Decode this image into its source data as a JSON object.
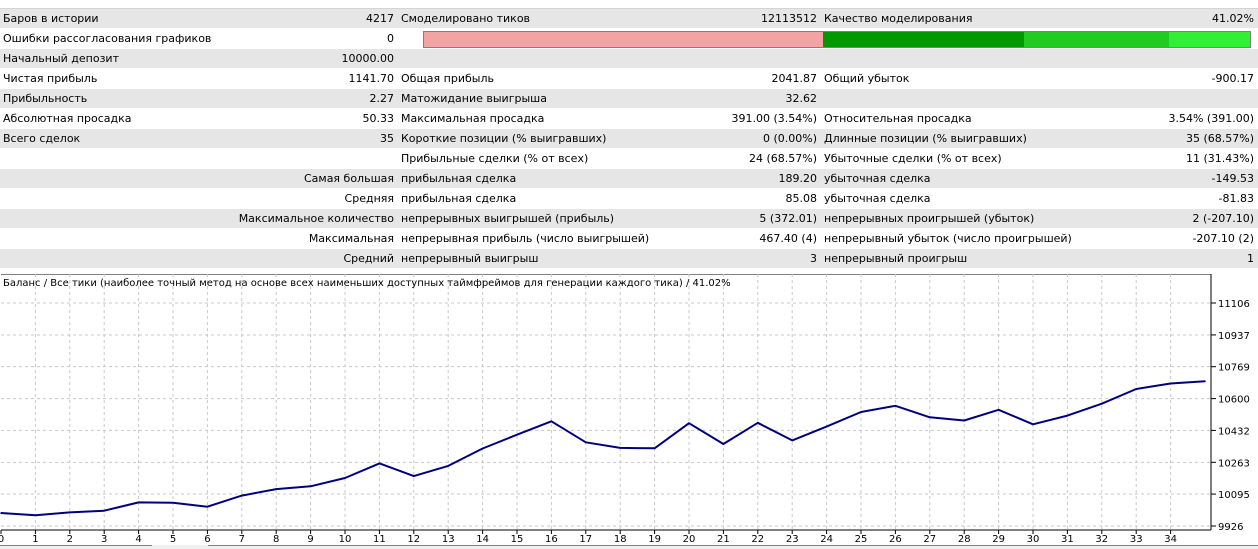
{
  "report": {
    "rows": [
      {
        "shade": "shade",
        "c1": "Баров в истории",
        "v1": "4217",
        "c2": "Смоделировано тиков",
        "v2": "12113512",
        "c3": "Качество моделирования",
        "v3": "41.02%"
      },
      {
        "shade": "plain",
        "c1": "Ошибки рассогласования графиков",
        "v1": "0",
        "bar": true
      },
      {
        "shade": "shade",
        "c1": "Начальный депозит",
        "v1": "10000.00",
        "c2": "",
        "v2": "",
        "c3": "",
        "v3": ""
      },
      {
        "shade": "plain",
        "c1": "Чистая прибыль",
        "v1": "1141.70",
        "c2": "Общая прибыль",
        "v2": "2041.87",
        "c3": "Общий убыток",
        "v3": "-900.17"
      },
      {
        "shade": "shade",
        "c1": "Прибыльность",
        "v1": "2.27",
        "c2": "Матожидание выигрыша",
        "v2": "32.62",
        "c3": "",
        "v3": ""
      },
      {
        "shade": "plain",
        "c1": "Абсолютная просадка",
        "v1": "50.33",
        "c2": "Максимальная просадка",
        "v2": "391.00 (3.54%)",
        "c3": "Относительная просадка",
        "v3": "3.54% (391.00)"
      },
      {
        "shade": "shade",
        "c1": "Всего сделок",
        "v1": "35",
        "c2": "Короткие позиции (% выигравших)",
        "v2": "0 (0.00%)",
        "c3": "Длинные позиции (% выигравших)",
        "v3": "35 (68.57%)"
      },
      {
        "shade": "plain",
        "c1": "",
        "v1": "",
        "c2": "Прибыльные сделки (% от всех)",
        "v2": "24 (68.57%)",
        "c3": "Убыточные сделки (% от всех)",
        "v3": "11 (31.43%)"
      },
      {
        "shade": "shade",
        "c1": "",
        "v1": "Самая большая",
        "c2": "прибыльная сделка",
        "v2": "189.20",
        "c3": "убыточная сделка",
        "v3": "-149.53"
      },
      {
        "shade": "plain",
        "c1": "",
        "v1": "Средняя",
        "c2": "прибыльная сделка",
        "v2": "85.08",
        "c3": "убыточная сделка",
        "v3": "-81.83"
      },
      {
        "shade": "shade",
        "c1": "",
        "v1": "Максимальное количество",
        "c2": "непрерывных выигрышей (прибыль)",
        "v2": "5 (372.01)",
        "c3": "непрерывных проигрышей (убыток)",
        "v3": "2 (-207.10)"
      },
      {
        "shade": "plain",
        "c1": "",
        "v1": "Максимальная",
        "c2": "непрерывная прибыль (число выигрышей)",
        "v2": "467.40 (4)",
        "c3": "непрерывный убыток (число проигрышей)",
        "v3": "-207.10 (2)"
      },
      {
        "shade": "shade",
        "c1": "",
        "v1": "Средний",
        "c2": "непрерывный выигрыш",
        "v2": "3",
        "c3": "непрерывный проигрыш",
        "v3": "1"
      }
    ],
    "quality_segments": [
      {
        "color": "#f4a3a3",
        "share": 0.4831
      },
      {
        "color": "#009900",
        "share": 0.2427
      },
      {
        "color": "#1fcc1f",
        "share": 0.1765
      },
      {
        "color": "#33ee33",
        "share": 0.0977
      }
    ]
  },
  "chart_data": {
    "type": "line",
    "title": "Баланс / Все тики (наиболее точный метод на основе всех наименьших доступных таймфреймов для генерации каждого тика) / 41.02%",
    "x": [
      0,
      1,
      2,
      3,
      4,
      5,
      6,
      7,
      8,
      9,
      10,
      11,
      12,
      13,
      14,
      15,
      16,
      17,
      18,
      19,
      20,
      21,
      22,
      23,
      24,
      25,
      26,
      27,
      28,
      29,
      30,
      31,
      32,
      33,
      34,
      35
    ],
    "values": [
      9995,
      9983,
      9998,
      10007,
      10051,
      10049,
      10028,
      10087,
      10121,
      10136,
      10180,
      10257,
      10190,
      10244,
      10336,
      10409,
      10480,
      10369,
      10339,
      10337,
      10470,
      10360,
      10472,
      10379,
      10452,
      10529,
      10562,
      10501,
      10484,
      10541,
      10464,
      10510,
      10573,
      10651,
      10680,
      10692
    ],
    "x_ticks": [
      "0",
      "1",
      "2",
      "3",
      "4",
      "5",
      "6",
      "7",
      "8",
      "9",
      "10",
      "11",
      "12",
      "13",
      "14",
      "15",
      "16",
      "17",
      "18",
      "19",
      "20",
      "21",
      "22",
      "23",
      "24",
      "25",
      "26",
      "27",
      "28",
      "29",
      "30",
      "31",
      "32",
      "33",
      "34"
    ],
    "y_ticks": [
      9926,
      10095,
      10263,
      10432,
      10600,
      10769,
      10937,
      11106
    ],
    "ylim": [
      9926,
      11140
    ],
    "line_color": "#00007f",
    "grid": true
  }
}
